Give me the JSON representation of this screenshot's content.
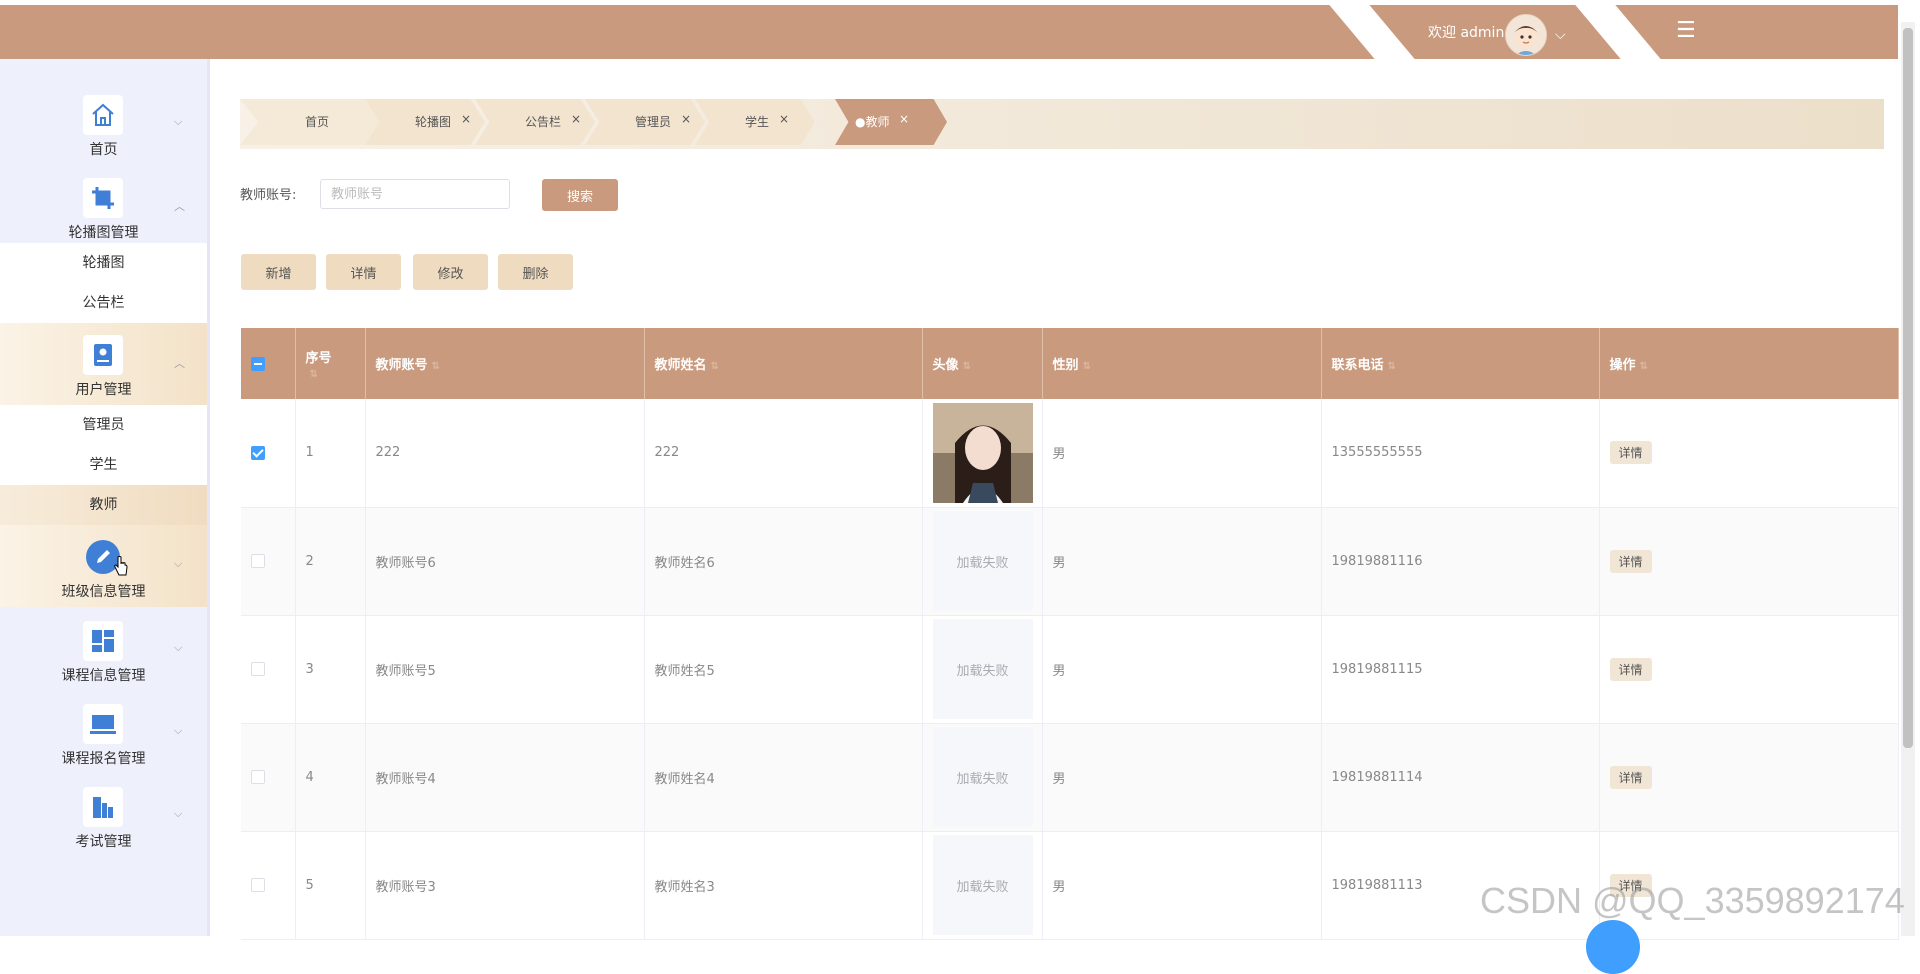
{
  "header": {
    "welcome": "欢迎 admin"
  },
  "sidebar": {
    "items": [
      {
        "label": "首页",
        "icon": "home-icon"
      },
      {
        "label": "轮播图管理",
        "icon": "crop-icon",
        "children": [
          "轮播图",
          "公告栏"
        ]
      },
      {
        "label": "用户管理",
        "icon": "user-card-icon",
        "children": [
          "管理员",
          "学生",
          "教师"
        ]
      },
      {
        "label": "班级信息管理",
        "icon": "edit-icon"
      },
      {
        "label": "课程信息管理",
        "icon": "dashboard-icon"
      },
      {
        "label": "课程报名管理",
        "icon": "laptop-icon"
      },
      {
        "label": "考试管理",
        "icon": "building-icon"
      }
    ]
  },
  "tabs": [
    "首页",
    "轮播图",
    "公告栏",
    "管理员",
    "学生",
    "●教师"
  ],
  "search": {
    "label": "教师账号:",
    "placeholder": "教师账号",
    "button": "搜索"
  },
  "actions": {
    "add": "新增",
    "detail": "详情",
    "edit": "修改",
    "delete": "删除"
  },
  "table": {
    "headers": [
      "序号",
      "教师账号",
      "教师姓名",
      "头像",
      "性别",
      "联系电话",
      "操作"
    ],
    "rows": [
      {
        "index": "1",
        "account": "222",
        "name": "222",
        "avatar": "",
        "gender": "男",
        "phone": "13555555555",
        "action": "详情"
      },
      {
        "index": "2",
        "account": "教师账号6",
        "name": "教师姓名6",
        "avatar": "加载失败",
        "gender": "男",
        "phone": "19819881116",
        "action": "详情"
      },
      {
        "index": "3",
        "account": "教师账号5",
        "name": "教师姓名5",
        "avatar": "加载失败",
        "gender": "男",
        "phone": "19819881115",
        "action": "详情"
      },
      {
        "index": "4",
        "account": "教师账号4",
        "name": "教师姓名4",
        "avatar": "加载失败",
        "gender": "男",
        "phone": "19819881114",
        "action": "详情"
      },
      {
        "index": "5",
        "account": "教师账号3",
        "name": "教师姓名3",
        "avatar": "加载失败",
        "gender": "男",
        "phone": "19819881113",
        "action": "详情"
      }
    ]
  },
  "watermark": "CSDN @QQ_3359892174",
  "colors": {
    "primary": "#c99a7e",
    "accent_soft": "#efdcc0",
    "checkbox": "#409eff",
    "sidebar_bg": "#eef0fc"
  }
}
